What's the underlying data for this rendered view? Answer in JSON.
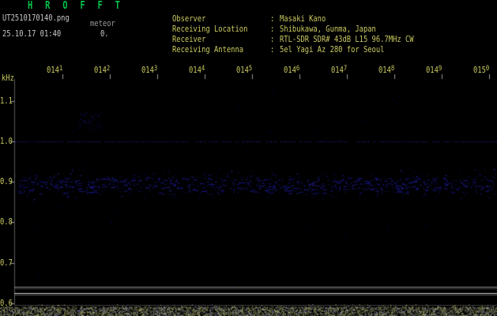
{
  "colors": {
    "bg": "#000000",
    "title_green": "#00c44a",
    "text_white": "#c8c8c8",
    "text_gray": "#989898",
    "text_yellow": "#c9c960",
    "axis_gray": "#5a5a5a",
    "tick_gray": "#9a9a9a",
    "ref_line_blue": "#2424ac",
    "noise_blue": "#1b1b8c",
    "level_bright": "#d2d2d2",
    "level_dim": "#8e8e8e"
  },
  "header": {
    "app_title": "H R O F F T",
    "filename": "UT2510170140.png",
    "mode": "meteor",
    "timestamp": "25.10.17 01:40",
    "counter": "0.",
    "info": [
      {
        "label": "Observer",
        "sep": ":",
        "value": "Masaki Kano"
      },
      {
        "label": "Receiving Location",
        "sep": ":",
        "value": "Shibukawa, Gunma, Japan"
      },
      {
        "label": "Receiver",
        "sep": ":",
        "value": "RTL-SDR SDR# 43dB L15 96.7MHz CW"
      },
      {
        "label": "Receiving Antenna",
        "sep": ":",
        "value": "5el Yagi Az 280 for Seoul"
      }
    ]
  },
  "axes": {
    "y_unit": "kHz",
    "y_ticks": [
      "1.1",
      "1.0",
      "0.9",
      "0.8",
      "0.7",
      "0.6"
    ],
    "x_ticks": [
      {
        "base": "014",
        "sup": "1"
      },
      {
        "base": "014",
        "sup": "2"
      },
      {
        "base": "014",
        "sup": "3"
      },
      {
        "base": "014",
        "sup": "4"
      },
      {
        "base": "014",
        "sup": "5"
      },
      {
        "base": "014",
        "sup": "6"
      },
      {
        "base": "014",
        "sup": "7"
      },
      {
        "base": "014",
        "sup": "8"
      },
      {
        "base": "014",
        "sup": "9"
      },
      {
        "base": "015",
        "sup": "0"
      }
    ]
  },
  "chart_data": {
    "type": "heatmap",
    "title": "",
    "ylabel": "kHz",
    "ylim": [
      0.6,
      1.15
    ],
    "y_tick_values": [
      1.1,
      1.0,
      0.9,
      0.8,
      0.7,
      0.6
    ],
    "x_tick_labels": [
      "0141",
      "0142",
      "0143",
      "0144",
      "0145",
      "0146",
      "0147",
      "0148",
      "0149",
      "0150"
    ],
    "time_span": "25.10.17 01:40 UT, 10 minutes",
    "features": [
      {
        "name": "reference-line",
        "khz": 1.0,
        "appearance": "dotted dark-blue horizontal line across full width"
      },
      {
        "name": "noise-band",
        "khz_range": [
          0.85,
          0.95
        ],
        "appearance": "sparse dark-blue speckle band, no meteor echoes visible"
      },
      {
        "name": "background-speckle",
        "appearance": "very sparse dark-blue dots scattered over the whole spectrogram"
      },
      {
        "name": "signal-level-trace",
        "appearance": "flat gray and bright-white horizontal lines near the bottom (constant noise floor)"
      },
      {
        "name": "level-strip",
        "appearance": "dense yellow/gray/blue speckle strip along the bottom edge"
      }
    ]
  }
}
